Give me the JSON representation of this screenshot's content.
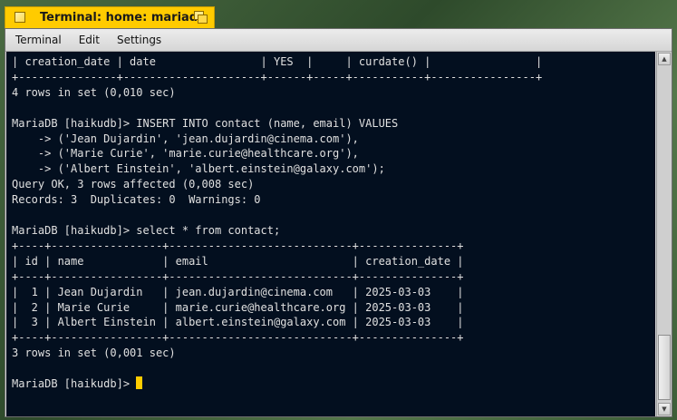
{
  "window": {
    "title": "Terminal: home: mariadb"
  },
  "menu": {
    "items": [
      "Terminal",
      "Edit",
      "Settings"
    ]
  },
  "terminal": {
    "lines": [
      "| creation_date | date                | YES  |     | curdate() |                |",
      "+---------------+---------------------+------+-----+-----------+----------------+",
      "4 rows in set (0,010 sec)",
      "",
      "MariaDB [haikudb]> INSERT INTO contact (name, email) VALUES",
      "    -> ('Jean Dujardin', 'jean.dujardin@cinema.com'),",
      "    -> ('Marie Curie', 'marie.curie@healthcare.org'),",
      "    -> ('Albert Einstein', 'albert.einstein@galaxy.com');",
      "Query OK, 3 rows affected (0,008 sec)",
      "Records: 3  Duplicates: 0  Warnings: 0",
      "",
      "MariaDB [haikudb]> select * from contact;",
      "+----+-----------------+----------------------------+---------------+",
      "| id | name            | email                      | creation_date |",
      "+----+-----------------+----------------------------+---------------+",
      "|  1 | Jean Dujardin   | jean.dujardin@cinema.com   | 2025-03-03    |",
      "|  2 | Marie Curie     | marie.curie@healthcare.org | 2025-03-03    |",
      "|  3 | Albert Einstein | albert.einstein@galaxy.com | 2025-03-03    |",
      "+----+-----------------+----------------------------+---------------+",
      "3 rows in set (0,001 sec)",
      "",
      "MariaDB [haikudb]> "
    ]
  },
  "colors": {
    "tab": "#ffcb00",
    "terminal_bg": "#030f1f",
    "terminal_fg": "#e0e0e0",
    "cursor": "#ffcc00"
  },
  "icons": {
    "close": "close-box-icon",
    "zoom": "zoom-box-icon"
  }
}
